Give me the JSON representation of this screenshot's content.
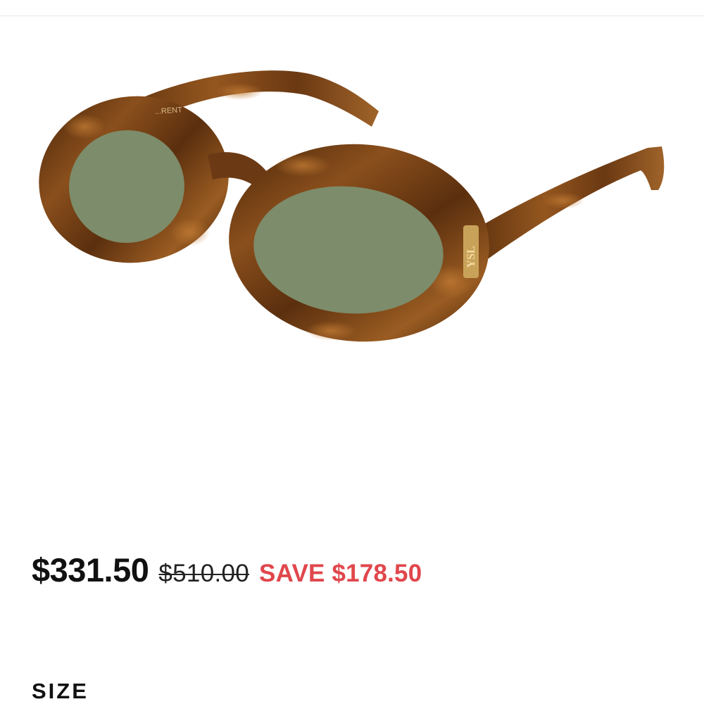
{
  "product": {
    "image_alt": "Oval tortoiseshell sunglasses with green lenses",
    "frame_color": "#6b3a15",
    "lens_color": "#7d8c6a",
    "temple_text": "...RENT",
    "logo_text": "YSL"
  },
  "pricing": {
    "current_price": "$331.50",
    "original_price": "$510.00",
    "savings_text": "SAVE $178.50",
    "savings_color": "#e0474c"
  },
  "options": {
    "size_heading": "SIZE"
  }
}
